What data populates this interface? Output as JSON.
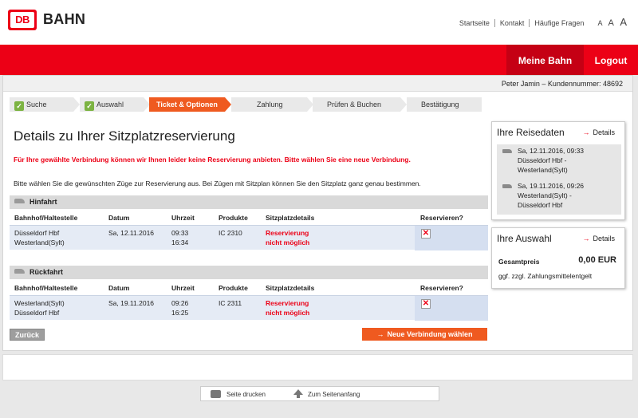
{
  "header": {
    "logo_text": "DB",
    "brand": "BAHN",
    "links": [
      "Startseite",
      "Kontakt",
      "Häufige Fragen"
    ],
    "font_sizes": [
      "A",
      "A",
      "A"
    ],
    "meine_bahn": "Meine Bahn",
    "logout": "Logout"
  },
  "user_line": "Peter Jamin – Kundennummer: 48692",
  "steps": [
    "Suche",
    "Auswahl",
    "Ticket & Optionen",
    "Zahlung",
    "Prüfen & Buchen",
    "Bestätigung"
  ],
  "main": {
    "title": "Details zu Ihrer Sitzplatzreservierung",
    "warning": "Für Ihre gewählte Verbindung können wir Ihnen leider keine Reservierung anbieten. Bitte wählen Sie eine neue Verbindung.",
    "info": "Bitte wählen Sie die gewünschten Züge zur Reservierung aus. Bei Zügen mit Sitzplan können Sie den Sitzplatz ganz genau bestimmen.",
    "columns": [
      "Bahnhof/Haltestelle",
      "Datum",
      "Uhrzeit",
      "Produkte",
      "Sitzplatzdetails",
      "Reservieren?"
    ],
    "hinfahrt": {
      "label": "Hinfahrt",
      "from": "Düsseldorf Hbf",
      "to": "Westerland(Sylt)",
      "date": "Sa, 12.11.2016",
      "dep": "09:33",
      "arr": "16:34",
      "product": "IC 2310",
      "seat1": "Reservierung",
      "seat2": "nicht möglich"
    },
    "rueckfahrt": {
      "label": "Rückfahrt",
      "from": "Westerland(Sylt)",
      "to": "Düsseldorf Hbf",
      "date": "Sa, 19.11.2016",
      "dep": "09:26",
      "arr": "16:25",
      "product": "IC 2311",
      "seat1": "Reservierung",
      "seat2": "nicht möglich"
    },
    "back_button": "Zurück",
    "new_button": "Neue Verbindung wählen"
  },
  "sidebar": {
    "reisedaten_title": "Ihre Reisedaten",
    "details_label": "Details",
    "trip1": {
      "date": "Sa, 12.11.2016, 09:33",
      "route1": "Düsseldorf Hbf -",
      "route2": "Westerland(Sylt)"
    },
    "trip2": {
      "date": "Sa, 19.11.2016, 09:26",
      "route1": "Westerland(Sylt) -",
      "route2": "Düsseldorf Hbf"
    },
    "auswahl_title": "Ihre Auswahl",
    "gesamtpreis_label": "Gesamtpreis",
    "gesamtpreis_value": "0,00 EUR",
    "fee_note": "ggf. zzgl. Zahlungsmittelentgelt"
  },
  "footer": {
    "print": "Seite drucken",
    "top": "Zum Seitenanfang"
  },
  "colors": {
    "db_red": "#ec0016",
    "orange": "#ef5a20"
  }
}
